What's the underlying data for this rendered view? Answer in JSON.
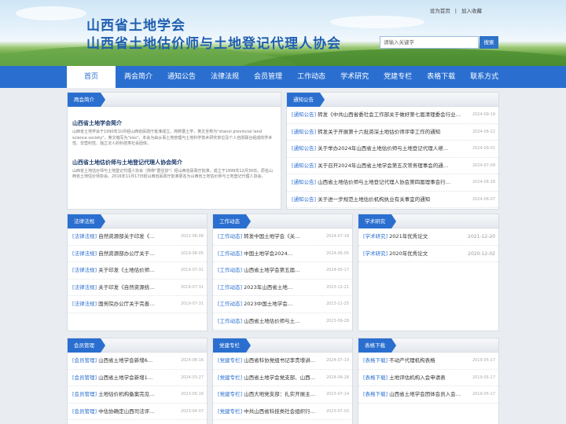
{
  "header": {
    "title_line1": "山西省土地学会",
    "title_line2": "山西省土地估价师与土地登记代理人协会",
    "toplinks": {
      "homepage": "设为首页",
      "separator": "|",
      "favorite": "加入收藏"
    },
    "search": {
      "placeholder": "请输入关键字",
      "button": "搜索"
    }
  },
  "nav": {
    "items": [
      {
        "label": "首页",
        "active": true
      },
      {
        "label": "两会简介"
      },
      {
        "label": "通知公告"
      },
      {
        "label": "法律法规"
      },
      {
        "label": "会员管理"
      },
      {
        "label": "工作动态"
      },
      {
        "label": "学术研究"
      },
      {
        "label": "党建专栏"
      },
      {
        "label": "表格下载"
      },
      {
        "label": "联系方式"
      }
    ]
  },
  "intro": {
    "heading": "两会简介",
    "blocks": [
      {
        "title": "山西省土地学会简介",
        "text": "山西省土地学会于1990年10月经山西省民政厅批准成立。简称晋土学，英文全称为\"shanxi provincial land science society\"，英文缩写为\"slss\"。本会为由从事土地管理与土地科学技术研究单位及个人自愿联合组成的学术性、非营利性、独立法人的科技类社会团体。"
      },
      {
        "title": "山西省土地估价师与土地登记代理人协会简介",
        "text": "山西省土地估价师与土地登记代理人协会（简称\"晋估协\"）经山西省民政厅批准，成立于1999年12月30日。原名山西省土地估价师协会。2016年11月17日经山西省民政厅批准更名为山西省土地估价师与土地登记代理人协会。"
      }
    ]
  },
  "notices": {
    "heading": "通知公告",
    "rows": [
      {
        "tag": "[通知公告]",
        "text": "转发《中共山西省委社会工作部关于做好第七届清理委会行业…",
        "date": "2024-09-19"
      },
      {
        "tag": "[通知公告]",
        "text": "转发关于开展第十六批资深土地估价师评审工作的通知",
        "date": "2024-08-22"
      },
      {
        "tag": "[通知公告]",
        "text": "关于举办2024年山西省土地估价师与土地登记代理人继…",
        "date": "2024-09-01"
      },
      {
        "tag": "[通知公告]",
        "text": "关于召开2024年山西省土地学会第五次常务理事会的通…",
        "date": "2024-07-09"
      },
      {
        "tag": "[通知公告]",
        "text": "山西省土地估价师与土地登记代理人协会第四届理事会行…",
        "date": "2024-06-18"
      },
      {
        "tag": "[通知公告]",
        "text": "关于进一步规范土地估价机构执业有关事宜的通知",
        "date": "2024-06-07"
      }
    ]
  },
  "laws": {
    "heading": "法律法规",
    "rows": [
      {
        "tag": "[法律法规]",
        "text": "自然资源部关于印发《…",
        "date": "2022-06-06"
      },
      {
        "tag": "[法律法规]",
        "text": "自然资源部办公厅关于…",
        "date": "2019-08-05"
      },
      {
        "tag": "[法律法规]",
        "text": "关于印发《土地估价师…",
        "date": "2019-07-31"
      },
      {
        "tag": "[法律法规]",
        "text": "关于印发《自然资源统…",
        "date": "2019-07-31"
      },
      {
        "tag": "[法律法规]",
        "text": "国务院办公厅关于完善…",
        "date": "2019-07-31"
      }
    ]
  },
  "work": {
    "heading": "工作动态",
    "rows": [
      {
        "tag": "[工作动态]",
        "text": "转发中国土地学会《关…",
        "date": "2024-07-18"
      },
      {
        "tag": "[工作动态]",
        "text": "中国土地学会2024…",
        "date": "2024-06-05"
      },
      {
        "tag": "[工作动态]",
        "text": "山西省土地学会第五届…",
        "date": "2024-05-17"
      },
      {
        "tag": "[工作动态]",
        "text": "2023年山西省土地…",
        "date": "2023-12-21"
      },
      {
        "tag": "[工作动态]",
        "text": "2023中国土地学会…",
        "date": "2023-11-25"
      },
      {
        "tag": "[工作动态]",
        "text": "山西省土地估价师与土…",
        "date": "2023-09-28"
      }
    ]
  },
  "research": {
    "heading": "学术研究",
    "rows": [
      {
        "tag": "[学术研究]",
        "text": "2021年优秀论文",
        "date": "2021-12-20"
      },
      {
        "tag": "[学术研究]",
        "text": "2020年优秀论文",
        "date": "2020-12-02"
      }
    ]
  },
  "members": {
    "heading": "会员管理",
    "rows": [
      {
        "tag": "[会员管理]",
        "text": "山西省土地学会新增6…",
        "date": "2024-08-16"
      },
      {
        "tag": "[会员管理]",
        "text": "山西省土地学会新增1…",
        "date": "2024-03-27"
      },
      {
        "tag": "[会员管理]",
        "text": "土地估价机构备案完见…",
        "date": "2023-05-16"
      },
      {
        "tag": "[会员管理]",
        "text": "中估协确定山西司法评…",
        "date": "2023-04-07"
      }
    ]
  },
  "party": {
    "heading": "党建专栏",
    "rows": [
      {
        "tag": "[党建专栏]",
        "text": "山西省科协党组书记李贵增讲…",
        "date": "2024-07-19"
      },
      {
        "tag": "[党建专栏]",
        "text": "山西省土地学会党支部、山西…",
        "date": "2024-06-28"
      },
      {
        "tag": "[党建专栏]",
        "text": "山西大地党支部：扎实开展主…",
        "date": "2023-07-14"
      },
      {
        "tag": "[党建专栏]",
        "text": "中共山西省科技类社会组织行…",
        "date": "2023-07-03"
      }
    ]
  },
  "forms": {
    "heading": "表格下载",
    "rows": [
      {
        "tag": "[表格下载]",
        "text": "不动产代理机构表格",
        "date": "2019-05-17"
      },
      {
        "tag": "[表格下载]",
        "text": "土地评估机构入会申请表",
        "date": "2019-05-17"
      },
      {
        "tag": "[表格下载]",
        "text": "山西省土地学会团体会员入会…",
        "date": "2019-05-17"
      }
    ]
  }
}
